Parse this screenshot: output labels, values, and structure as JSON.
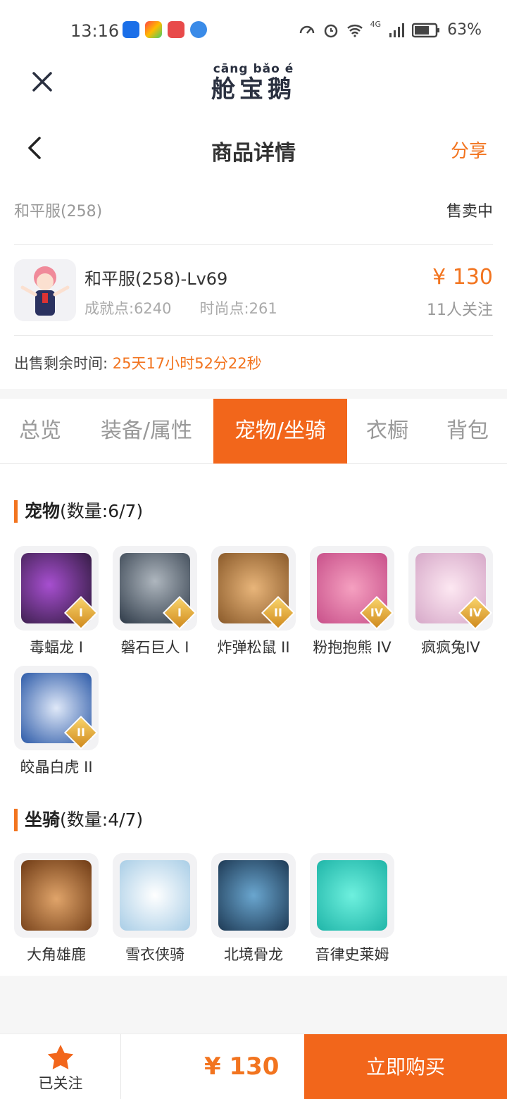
{
  "status_bar": {
    "time": "13:16",
    "battery": "63%",
    "network": "4G",
    "icons": [
      "data-speed-icon",
      "alarm-icon",
      "wifi-icon",
      "signal-icon",
      "battery-icon"
    ]
  },
  "app": {
    "logo_pinyin": "cāng bǎo  é",
    "logo_text": "舱宝鹅"
  },
  "nav": {
    "title": "商品详情",
    "share_label": "分享"
  },
  "listing": {
    "server": "和平服(258)",
    "status": "售卖中",
    "product_name": "和平服(258)-Lv69",
    "achievement": "成就点:6240",
    "fashion": "时尚点:261",
    "price": "¥ 130",
    "followers": "11人关注",
    "time_label": "出售剩余时间:",
    "time_value": "25天17小时52分22秒"
  },
  "tabs": [
    {
      "label": "总览",
      "active": false
    },
    {
      "label": "装备/属性",
      "active": false
    },
    {
      "label": "宠物/坐骑",
      "active": true
    },
    {
      "label": "衣橱",
      "active": false
    },
    {
      "label": "背包",
      "active": false
    }
  ],
  "pets": {
    "title": "宠物",
    "count_label": "(数量:6/7)",
    "items": [
      {
        "name": "毒蝠龙 I",
        "rank": "I",
        "color": "#5b2a7a"
      },
      {
        "name": "磐石巨人 I",
        "rank": "I",
        "color": "#5a6878"
      },
      {
        "name": "炸弹松鼠 II",
        "rank": "II",
        "color": "#b07a44"
      },
      {
        "name": "粉抱抱熊 IV",
        "rank": "IV",
        "color": "#e8739a"
      },
      {
        "name": "疯疯兔IV",
        "rank": "IV",
        "color": "#f1c6dc"
      },
      {
        "name": "皎晶白虎 II",
        "rank": "II",
        "color": "#4d7cc8"
      }
    ]
  },
  "mounts": {
    "title": "坐骑",
    "count_label": "(数量:4/7)",
    "items": [
      {
        "name": "大角雄鹿",
        "color": "#b5703a"
      },
      {
        "name": "雪衣侠骑",
        "color": "#cfe4f2"
      },
      {
        "name": "北境骨龙",
        "color": "#2d5f86"
      },
      {
        "name": "音律史莱姆",
        "color": "#3fd3c6"
      }
    ]
  },
  "bottom": {
    "follow_label": "已关注",
    "price": "¥ 130",
    "buy_label": "立即购买"
  },
  "colors": {
    "accent": "#f2741f",
    "tab_active": "#f2661b"
  }
}
